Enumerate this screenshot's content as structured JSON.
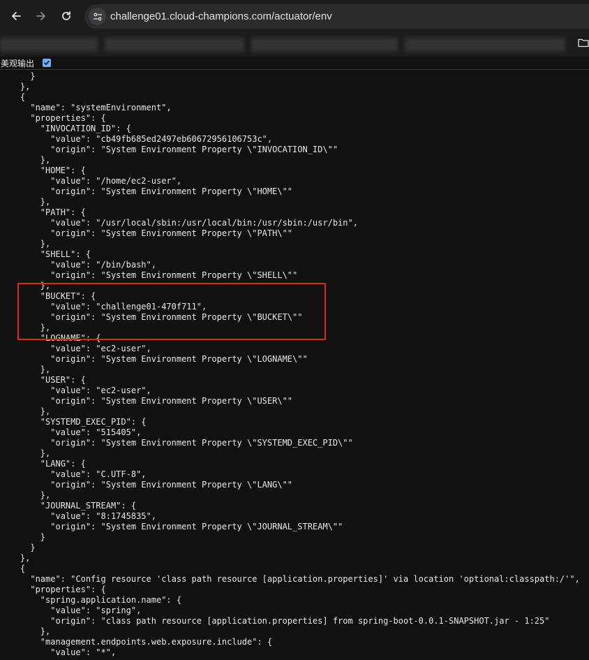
{
  "browser": {
    "url": "challenge01.cloud-champions.com/actuator/env"
  },
  "toolbar_icons": [
    "back-icon",
    "forward-icon",
    "reload-icon",
    "site-info-icon",
    "folder-icon"
  ],
  "page": {
    "pretty_print_label": "美观输出",
    "pretty_print_checked": true,
    "lines": [
      "      }",
      "    },",
      "    {",
      "      \"name\": \"systemEnvironment\",",
      "      \"properties\": {",
      "        \"INVOCATION_ID\": {",
      "          \"value\": \"cb49fb685ed2497eb60672956106753c\",",
      "          \"origin\": \"System Environment Property \\\"INVOCATION_ID\\\"\"",
      "        },",
      "        \"HOME\": {",
      "          \"value\": \"/home/ec2-user\",",
      "          \"origin\": \"System Environment Property \\\"HOME\\\"\"",
      "        },",
      "        \"PATH\": {",
      "          \"value\": \"/usr/local/sbin:/usr/local/bin:/usr/sbin:/usr/bin\",",
      "          \"origin\": \"System Environment Property \\\"PATH\\\"\"",
      "        },",
      "        \"SHELL\": {",
      "          \"value\": \"/bin/bash\",",
      "          \"origin\": \"System Environment Property \\\"SHELL\\\"\"",
      "        },",
      "        \"BUCKET\": {",
      "          \"value\": \"challenge01-470f711\",",
      "          \"origin\": \"System Environment Property \\\"BUCKET\\\"\"",
      "        },",
      "        \"LOGNAME\": {",
      "          \"value\": \"ec2-user\",",
      "          \"origin\": \"System Environment Property \\\"LOGNAME\\\"\"",
      "        },",
      "        \"USER\": {",
      "          \"value\": \"ec2-user\",",
      "          \"origin\": \"System Environment Property \\\"USER\\\"\"",
      "        },",
      "        \"SYSTEMD_EXEC_PID\": {",
      "          \"value\": \"515405\",",
      "          \"origin\": \"System Environment Property \\\"SYSTEMD_EXEC_PID\\\"\"",
      "        },",
      "        \"LANG\": {",
      "          \"value\": \"C.UTF-8\",",
      "          \"origin\": \"System Environment Property \\\"LANG\\\"\"",
      "        },",
      "        \"JOURNAL_STREAM\": {",
      "          \"value\": \"8:1745835\",",
      "          \"origin\": \"System Environment Property \\\"JOURNAL_STREAM\\\"\"",
      "        }",
      "      }",
      "    },",
      "    {",
      "      \"name\": \"Config resource 'class path resource [application.properties]' via location 'optional:classpath:/'\",",
      "      \"properties\": {",
      "        \"spring.application.name\": {",
      "          \"value\": \"spring\",",
      "          \"origin\": \"class path resource [application.properties] from spring-boot-0.0.1-SNAPSHOT.jar - 1:25\"",
      "        },",
      "        \"management.endpoints.web.exposure.include\": {",
      "          \"value\": \"*\","
    ]
  },
  "highlight": {
    "color": "#e0251b",
    "target": "BUCKET"
  }
}
